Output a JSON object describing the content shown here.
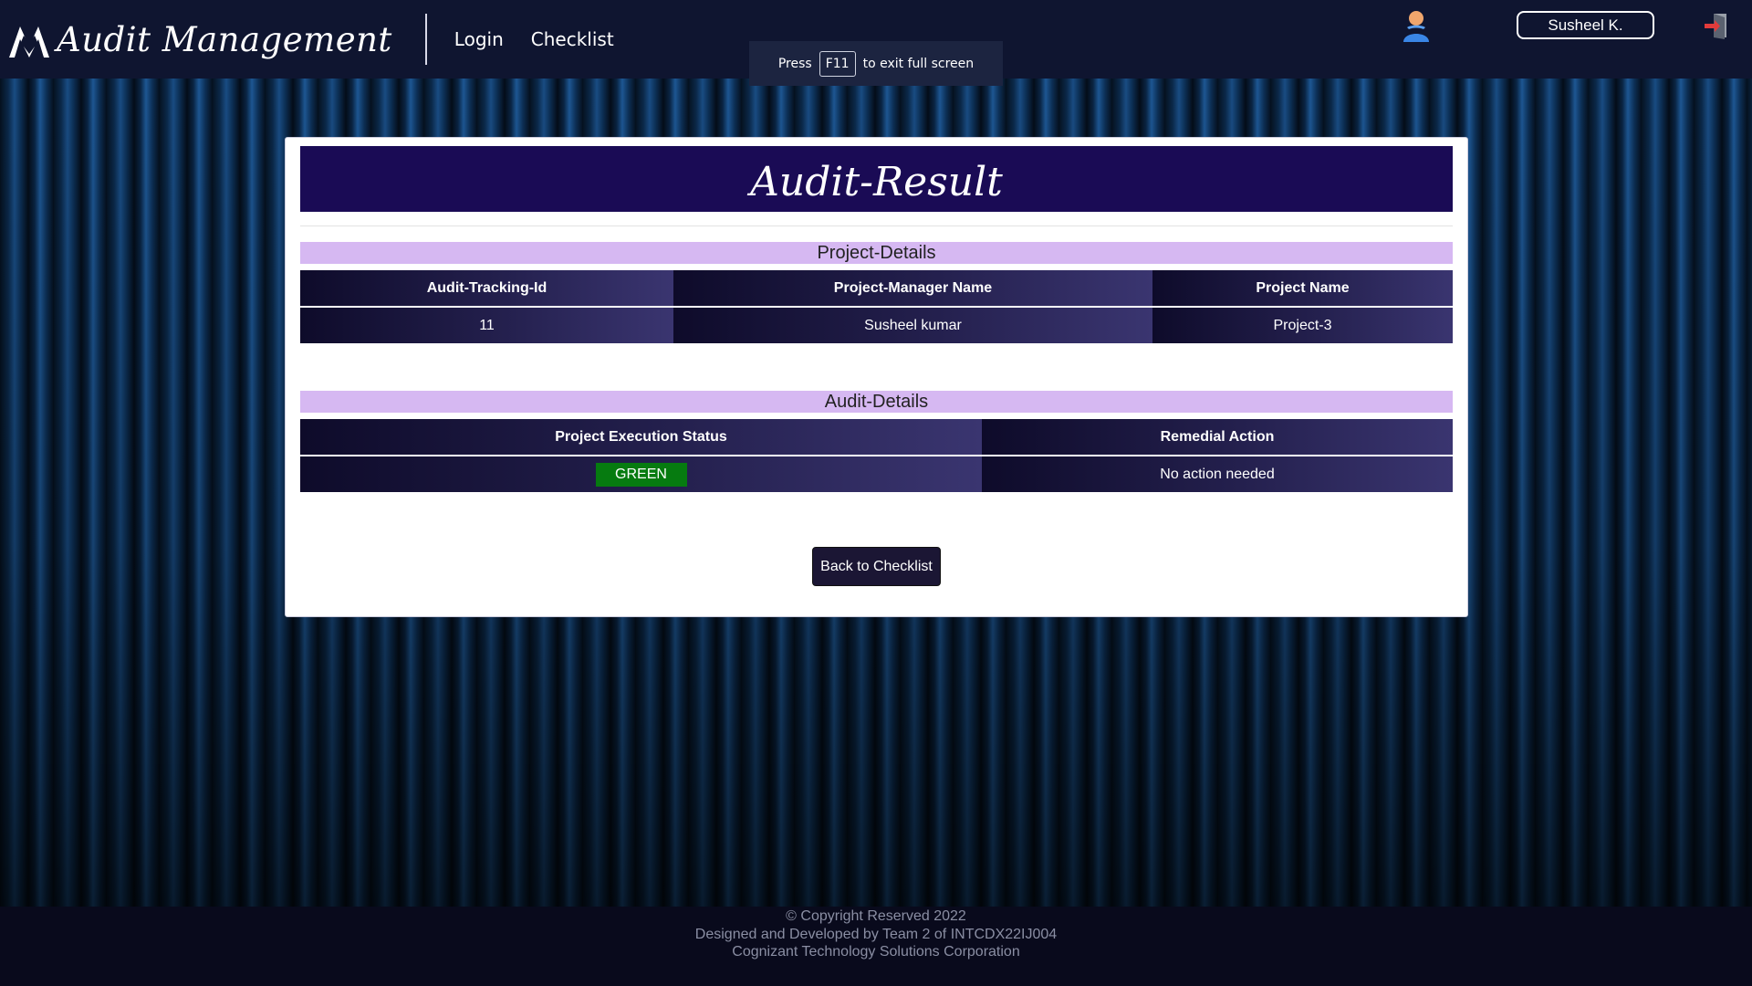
{
  "navbar": {
    "brand": "Audit Management",
    "links": [
      "Login",
      "Checklist"
    ],
    "user_name": "Susheel K.",
    "icons": {
      "logo": "audit-logo-icon",
      "user": "user-avatar-icon",
      "logout": "logout-icon"
    }
  },
  "fullscreen_toast": {
    "prefix": "Press",
    "key": "F11",
    "suffix": "to exit full screen"
  },
  "page": {
    "title": "Audit-Result",
    "project_section": {
      "title": "Project-Details",
      "headers": [
        "Audit-Tracking-Id",
        "Project-Manager Name",
        "Project Name"
      ],
      "row": [
        "11",
        "Susheel kumar",
        "Project-3"
      ]
    },
    "audit_section": {
      "title": "Audit-Details",
      "headers": [
        "Project Execution Status",
        "Remedial Action"
      ],
      "status": "GREEN",
      "status_color": "#067b10",
      "remedial_action": "No action needed"
    },
    "back_button": "Back to Checklist"
  },
  "footer": {
    "line1": "© Copyright Reserved 2022",
    "line2": "Designed and Developed by Team 2 of INTCDX22IJ004",
    "line3": "Cognizant Technology Solutions Corporation"
  },
  "colors": {
    "navbar": "#0f1530",
    "card_header": "#1a0b55",
    "section_title": "#d6b8f2",
    "status_green": "#067b10"
  }
}
